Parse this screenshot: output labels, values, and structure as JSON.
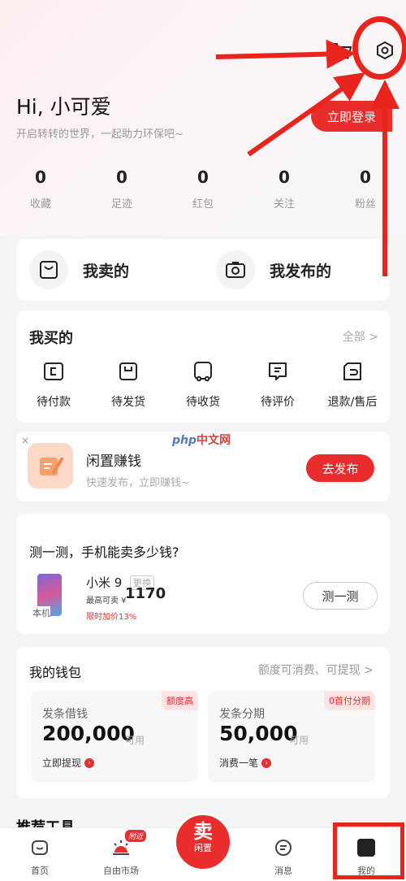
{
  "header": {
    "greeting": "Hi, 小可爱",
    "subtitle": "开启转转的世界，一起助力环保吧~",
    "login_label": "立即登录"
  },
  "stats": [
    {
      "value": "0",
      "label": "收藏"
    },
    {
      "value": "0",
      "label": "足迹"
    },
    {
      "value": "0",
      "label": "红包"
    },
    {
      "value": "0",
      "label": "关注"
    },
    {
      "value": "0",
      "label": "粉丝"
    }
  ],
  "sell_section": {
    "my_sold": "我卖的",
    "my_published": "我发布的"
  },
  "orders": {
    "title": "我买的",
    "all_label": "全部 >",
    "items": [
      {
        "label": "待付款",
        "icon": "wallet-icon"
      },
      {
        "label": "待发货",
        "icon": "package-icon"
      },
      {
        "label": "待收货",
        "icon": "truck-icon"
      },
      {
        "label": "待评价",
        "icon": "comment-icon"
      },
      {
        "label": "退款/售后",
        "icon": "return-icon"
      }
    ]
  },
  "promo": {
    "close": "×",
    "title": "闲置赚钱",
    "subtitle": "快速发布，立即赚钱~",
    "button": "去发布",
    "watermark_php": "php",
    "watermark_cn": "中文网"
  },
  "phone_test": {
    "title": "测一测，手机能卖多少钱?",
    "tag": "本机",
    "model": "小米 9",
    "switch": "更换",
    "price_label": "最高可卖 ¥",
    "price": "1170",
    "promo": "限时加价13%",
    "button": "测一测"
  },
  "wallet": {
    "title": "我的钱包",
    "right_label": "额度可消费、可提现 >",
    "boxes": [
      {
        "badge": "额度高",
        "name": "发条借钱",
        "amount": "200,000",
        "unit": "可用",
        "link": "立即提现"
      },
      {
        "badge": "0首付分期",
        "name": "发条分期",
        "amount": "50,000",
        "unit": "可用",
        "link": "消费一笔"
      }
    ]
  },
  "recommend_title": "推荐工具",
  "tabbar": {
    "home": "首页",
    "market": "自由市场",
    "market_badge": "附近",
    "sell_big": "卖",
    "sell_small": "闲置",
    "message": "消息",
    "mine": "我的"
  },
  "colors": {
    "accent": "#e92c2c",
    "annotation": "#e8251d"
  }
}
